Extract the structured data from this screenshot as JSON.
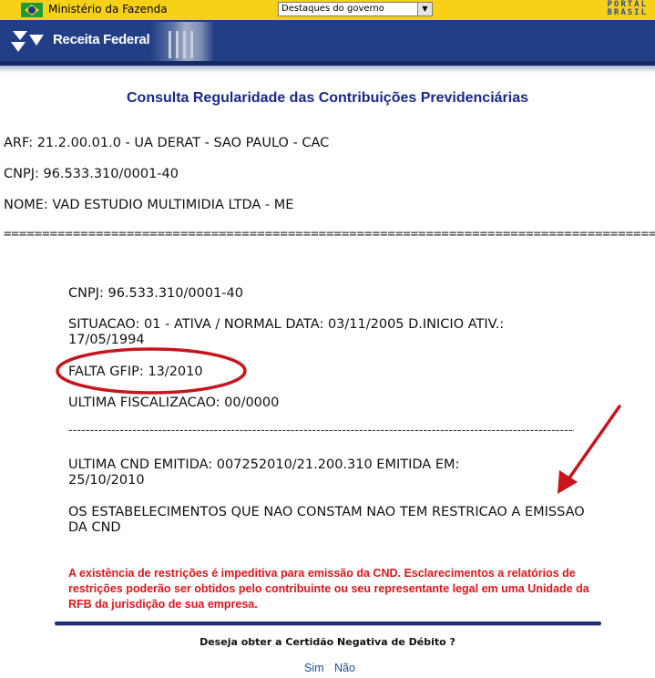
{
  "gov_bar": {
    "ministry": "Ministério da Fazenda",
    "select_value": "Destaques do governo",
    "portal_line1": "PORTAL",
    "portal_line2": "BRASIL"
  },
  "header": {
    "brand": "Receita Federal"
  },
  "page_title": "Consulta Regularidade das Contribuições Previdenciárias",
  "info": {
    "arf": "ARF: 21.2.00.01.0 - UA DERAT - SAO PAULO - CAC",
    "cnpj": "CNPJ: 96.533.310/0001-40",
    "nome": "NOME: VAD ESTUDIO MULTIMIDIA LTDA - ME"
  },
  "separator": "================================================================================================",
  "details": {
    "cnpj": "CNPJ: 96.533.310/0001-40",
    "situacao": "SITUACAO: 01 - ATIVA / NORMAL DATA: 03/11/2005 D.INICIO ATIV.: 17/05/1994",
    "falta_gfip": "FALTA GFIP: 13/2010",
    "ultima_fiscalizacao": "ULTIMA FISCALIZACAO: 00/0000",
    "dash_line": "------------------------------------------------------------------------------------------------------------------------",
    "ultima_cnd": "ULTIMA CND EMITIDA: 007252010/21.200.310 EMITIDA EM: 25/10/2010",
    "estabelecimentos": "OS ESTABELECIMENTOS QUE NAO CONSTAM NAO TEM RESTRICAO A EMISSAO DA CND"
  },
  "warning": "A existência de restrições é impeditiva para emissão da CND. Esclarecimentos a relatórios de restrições poderão ser obtidos pelo contribuinte ou seu representante legal em uma Unidade da RFB da jurisdição de sua empresa.",
  "question": "Deseja obter a Certidão Negativa de Débito ?",
  "options": {
    "yes": "Sim",
    "no": "Não"
  },
  "colors": {
    "gov_bar": "#f7d117",
    "header_blue": "#213e86",
    "title_blue": "#1a2a8c",
    "warning_red": "#e0151b",
    "annotation_red": "#c8141c",
    "link_blue": "#1a4ea8"
  },
  "icons": [
    "brazil-flag-icon",
    "dropdown-arrow-icon",
    "receita-federal-logo-icon",
    "building-image"
  ]
}
